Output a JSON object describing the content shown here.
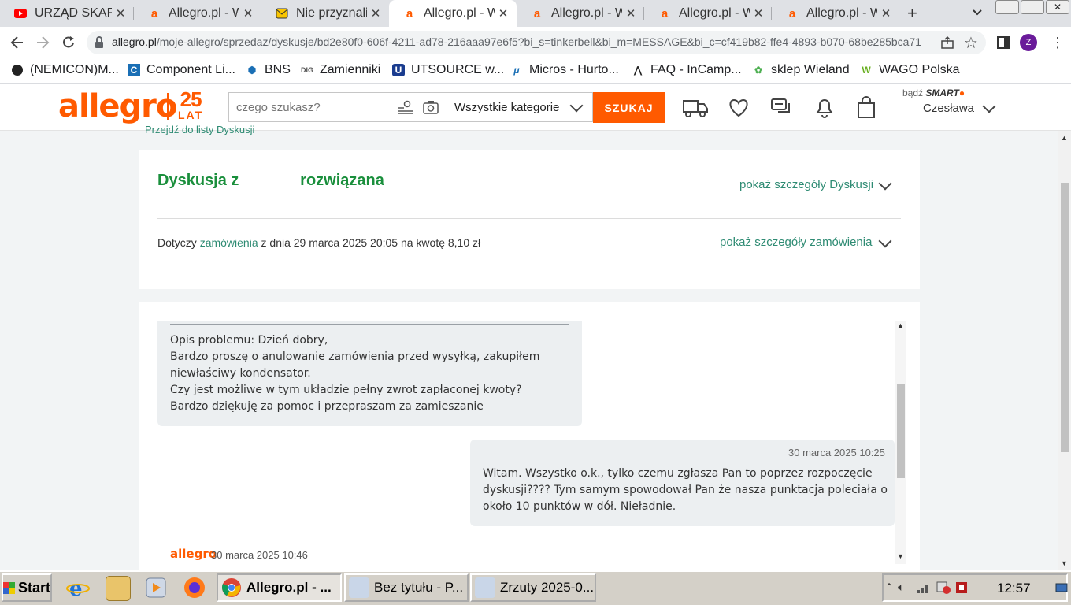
{
  "browser": {
    "tabs": [
      {
        "title": "URZĄD SKARBOWY",
        "favicon": "youtube-icon",
        "active": false
      },
      {
        "title": "Allegro.pl - Więcej",
        "favicon": "allegro-icon",
        "active": false
      },
      {
        "title": "Nie przyznaliśmy",
        "favicon": "mail-icon",
        "active": false
      },
      {
        "title": "Allegro.pl - Więcej",
        "favicon": "allegro-icon",
        "active": true
      },
      {
        "title": "Allegro.pl - Więcej",
        "favicon": "allegro-icon",
        "active": false
      },
      {
        "title": "Allegro.pl - Więcej",
        "favicon": "allegro-icon",
        "active": false
      },
      {
        "title": "Allegro.pl - Więcej",
        "favicon": "allegro-icon",
        "active": false
      }
    ],
    "new_tab": "+",
    "profile_initial": "Z",
    "url_domain": "allegro.pl",
    "url_path": "/moje-allegro/sprzedaz/dyskusje/bd2e80f0-606f-4211-ad78-216aaa97e6f5?bi_s=tinkerbell&bi_m=MESSAGE&bi_c=cf419b82-ffe4-4893-b070-68be285bca71",
    "bookmarks": [
      {
        "label": "(NEMICON)M...",
        "icon": "circle-icon"
      },
      {
        "label": "Component Li...",
        "icon": "component-icon"
      },
      {
        "label": "BNS",
        "icon": "shield-icon"
      },
      {
        "label": "Zamienniki",
        "icon": "dig-icon"
      },
      {
        "label": "UTSOURCE w...",
        "icon": "utsource-icon"
      },
      {
        "label": "Micros - Hurto...",
        "icon": "micros-icon"
      },
      {
        "label": "FAQ - InCamp...",
        "icon": "incamp-icon"
      },
      {
        "label": "sklep Wieland",
        "icon": "wieland-icon"
      },
      {
        "label": "WAGO Polska",
        "icon": "wago-icon"
      }
    ]
  },
  "header": {
    "logo": "allegro",
    "logo_badge_top": "25",
    "logo_badge_bottom": "LAT",
    "search_placeholder": "czego szukasz?",
    "category": "Wszystkie kategorie",
    "search_button": "SZUKAJ",
    "smart_prefix": "bądź",
    "smart_label": "SMART",
    "user_name": "Czesława"
  },
  "discussion": {
    "back_link": "Przejdź do listy Dyskusji",
    "title": "Dyskusja z              rozwiązana",
    "show_details": "pokaż szczegóły Dyskusji",
    "order_prefix": "Dotyczy",
    "order_link": "zamówienia",
    "order_suffix": "z dnia 29 marca 2025 20:05 na kwotę 8,10 zł",
    "show_order_details": "pokaż szczegóły zamówienia"
  },
  "messages": [
    {
      "text": "Opis problemu: Dzień dobry,\nBardzo proszę o anulowanie zamówienia przed wysyłką, zakupiłem\nniewłaściwy kondensator.\nCzy jest możliwe w tym układzie pełny zwrot zapłaconej kwoty?\nBardzo dziękuję za pomoc i przepraszam za zamieszanie"
    },
    {
      "date": "30 marca 2025 10:25",
      "text": "Witam. Wszystko o.k., tylko czemu zgłasza Pan to poprzez rozpoczęcie\ndyskusji???? Tym samym spowodował Pan że nasza punktacja poleciała o\nokoło 10 punktów w dół. Nieładnie."
    },
    {
      "sender": "allegro",
      "date": "30 marca 2025 10:46"
    }
  ],
  "taskbar": {
    "start": "Start",
    "windows": [
      {
        "label": "Allegro.pl - ...",
        "icon": "chrome-icon",
        "active": true
      },
      {
        "label": "Bez tytułu - P...",
        "icon": "paint-icon",
        "active": false
      },
      {
        "label": "Zrzuty 2025-0...",
        "icon": "paint-icon",
        "active": false
      }
    ],
    "clock": "12:57"
  },
  "colors": {
    "allegro_orange": "#ff5a00",
    "success_green": "#1a8f3c",
    "link_teal": "#2e8b73"
  }
}
